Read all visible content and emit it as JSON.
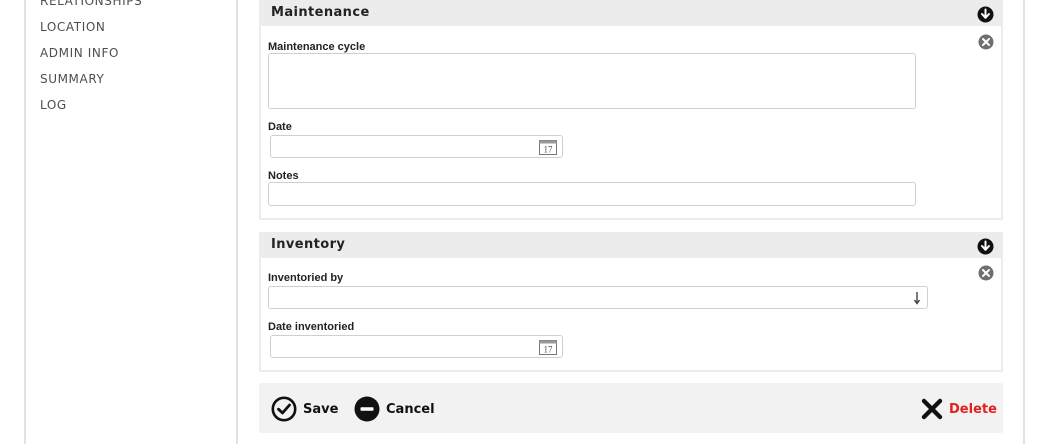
{
  "sidebar": {
    "items": [
      {
        "label": "RELATIONSHIPS"
      },
      {
        "label": "LOCATION"
      },
      {
        "label": "ADMIN INFO"
      },
      {
        "label": "SUMMARY"
      },
      {
        "label": "LOG"
      }
    ]
  },
  "maintenance": {
    "title": "Maintenance",
    "cycle_label": "Maintenance cycle",
    "cycle_value": "",
    "date_label": "Date",
    "date_value": "",
    "calendar_day": "17",
    "notes_label": "Notes",
    "notes_value": ""
  },
  "inventory": {
    "title": "Inventory",
    "by_label": "Inventoried by",
    "by_value": "",
    "date_label": "Date inventoried",
    "date_value": "",
    "calendar_day": "17"
  },
  "actions": {
    "save_label": "Save",
    "cancel_label": "Cancel",
    "delete_label": "Delete"
  },
  "colors": {
    "delete": "#e3211c",
    "panel_header": "#ececec",
    "border": "#cfcfcf"
  },
  "icons": {
    "collapse": "circle-arrow-down-icon",
    "remove": "circle-x-icon",
    "calendar": "calendar-icon",
    "select": "arrow-down-icon",
    "save": "circle-check-icon",
    "cancel": "circle-minus-icon",
    "delete": "x-icon"
  }
}
